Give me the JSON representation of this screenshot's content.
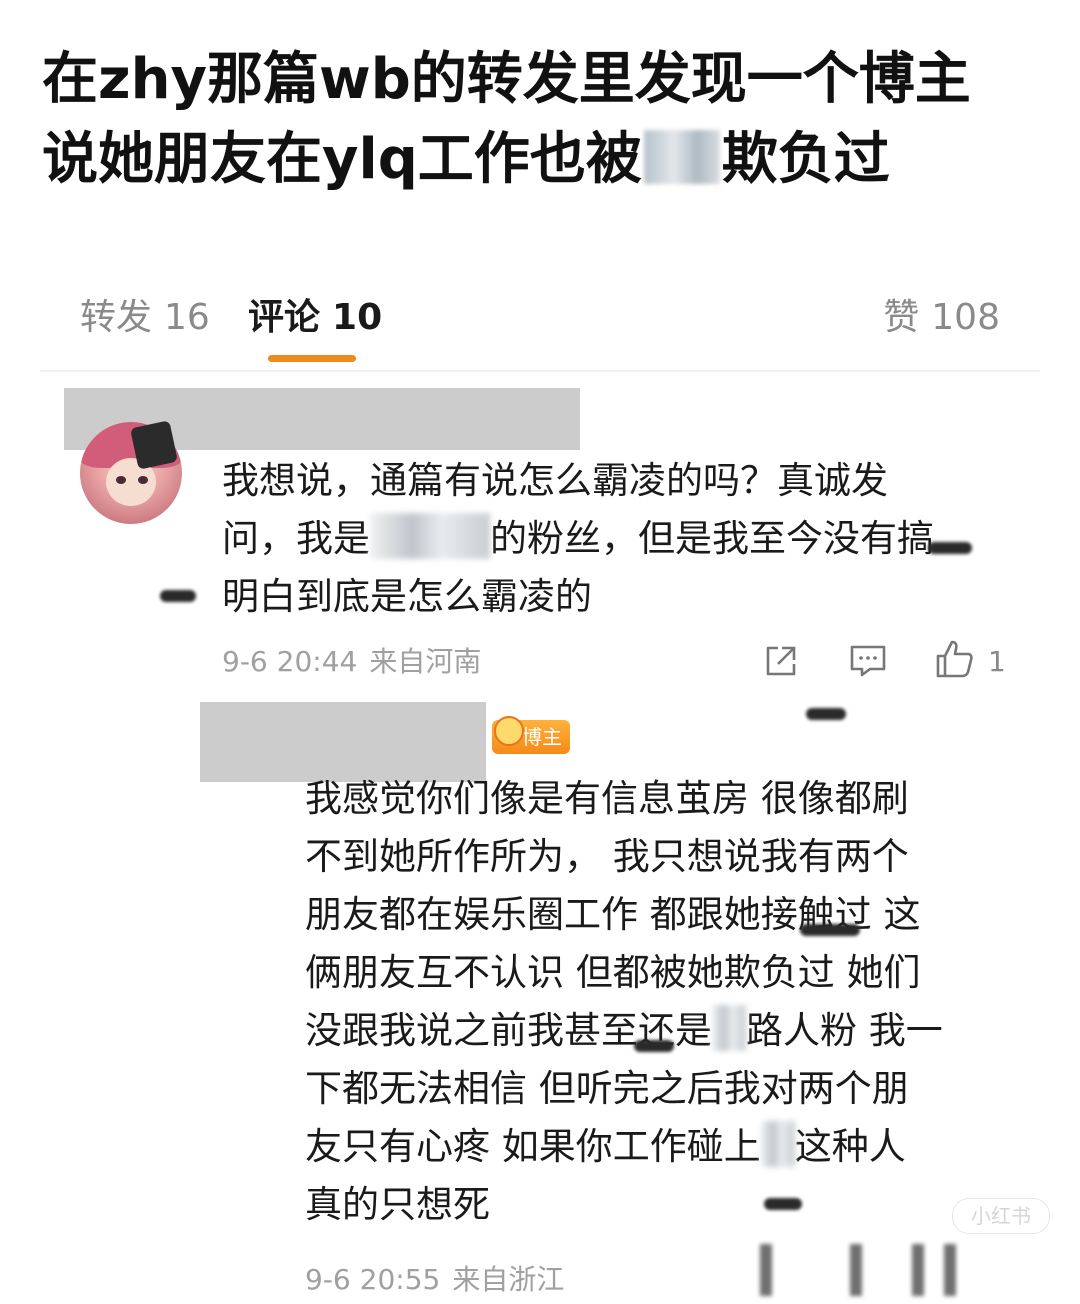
{
  "headline": {
    "line1": "在zhy那篇wb的转发里发现一个博主",
    "line2_before": "说她朋友在ylq工作也被",
    "line2_after": "欺负过"
  },
  "tabs": {
    "repost": {
      "label": "转发",
      "count": "16"
    },
    "comment": {
      "label": "评论",
      "count": "10"
    },
    "like": {
      "label": "赞",
      "count": "108"
    }
  },
  "comments": [
    {
      "lines": [
        {
          "before": "我想说，通篇有说怎么霸凌的吗？真诚发",
          "after": ""
        },
        {
          "before": "问，我是",
          "after": "的粉丝，但是我至今没有搞"
        },
        {
          "before": "明白到底是怎么霸凌的",
          "after": ""
        }
      ],
      "time": "9-6 20:44",
      "location": "来自河南",
      "like_count": "1"
    },
    {
      "badge": "博主",
      "lines": [
        "我感觉你们像是有信息茧房 很像都刷",
        "不到她所作所为， 我只想说我有两个",
        "朋友都在娱乐圈工作 都跟她接触过 这",
        "俩朋友互不认识 但都被她欺负过 她们"
      ],
      "line5_before": "没跟我说之前我甚至还是",
      "line5_after": "路人粉 我一",
      "line6": "下都无法相信 但听完之后我对两个朋",
      "line7_before": "友只有心疼  如果你工作碰上",
      "line7_after": "这种人",
      "line8": "真的只想死",
      "time": "9-6 20:55",
      "location": "来自浙江"
    }
  ],
  "watermark": "小红书",
  "colors": {
    "accent": "#f08a1c",
    "meta_text": "#a0a0a0",
    "tab_inactive": "#8a8a8a",
    "redaction": "#cccccc"
  },
  "icons": [
    "share-icon",
    "comment-icon",
    "thumbs-up-icon",
    "crown-icon"
  ]
}
